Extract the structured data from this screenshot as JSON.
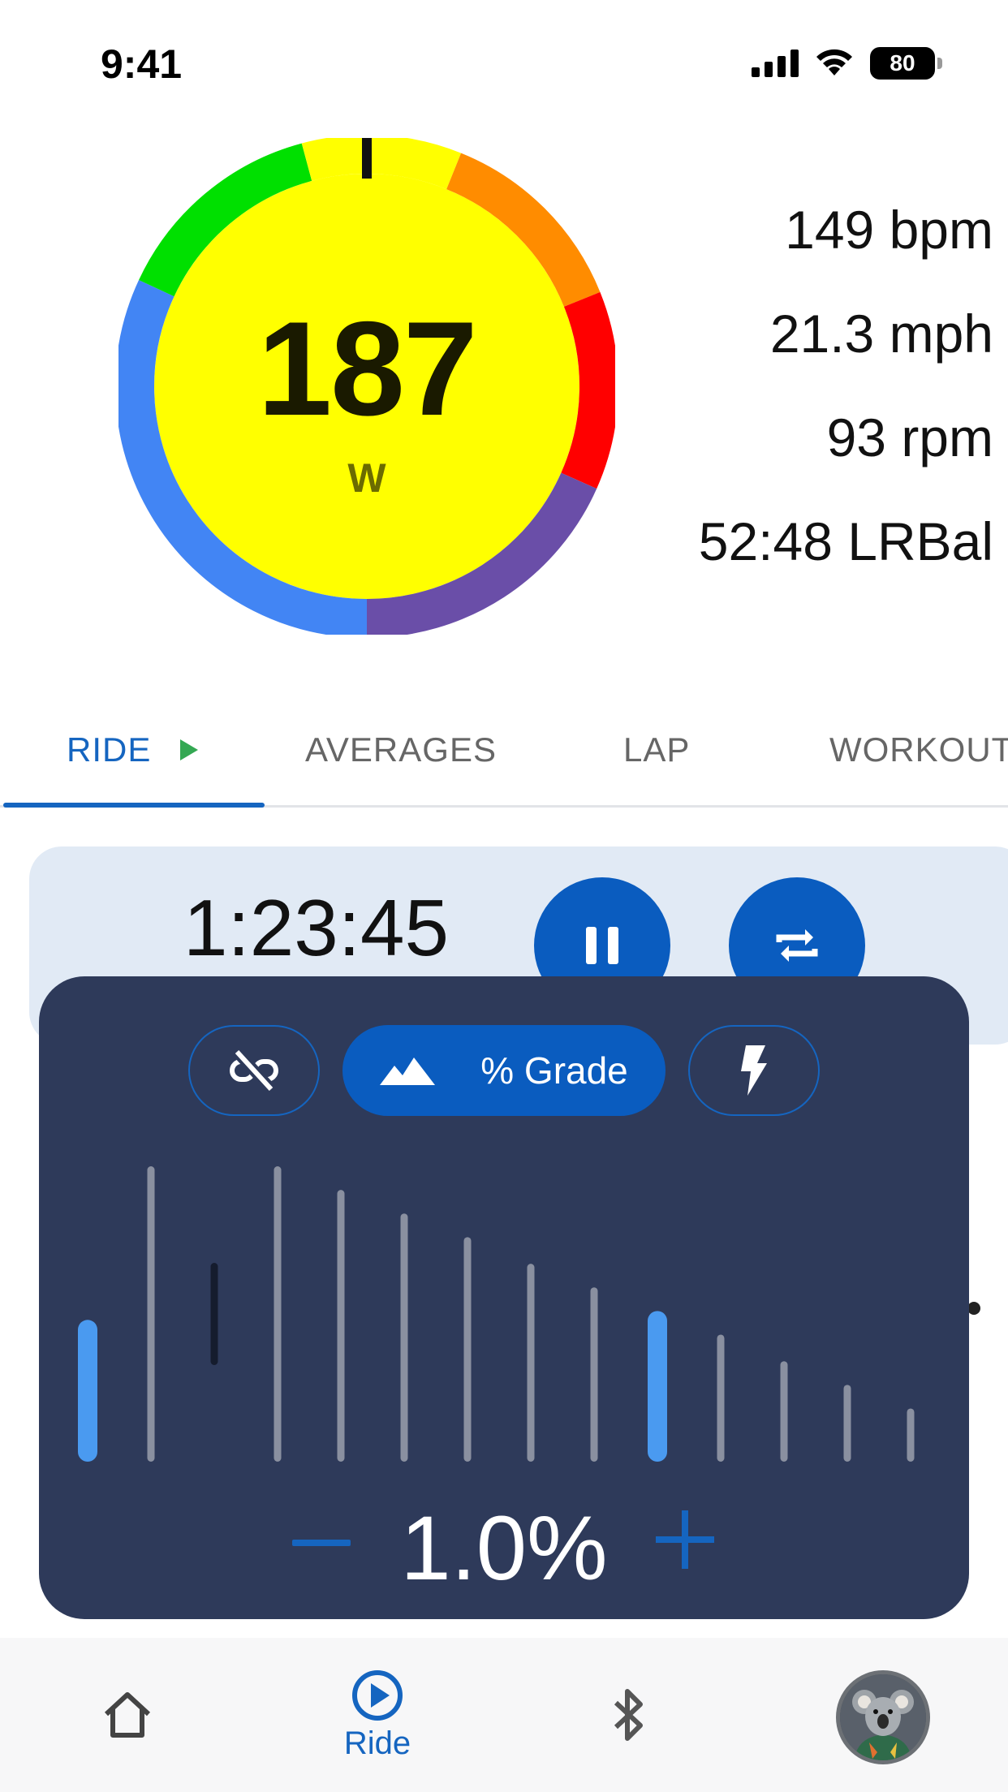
{
  "status_bar": {
    "time": "9:41",
    "battery": "80"
  },
  "gauge": {
    "value": "187",
    "unit": "W",
    "zone_colors": [
      "#4285f4",
      "#00e000",
      "#ffff00",
      "#ff8c00",
      "#ff0000",
      "#6a4ea8"
    ]
  },
  "metrics": [
    {
      "text": "149 bpm"
    },
    {
      "text": "21.3 mph"
    },
    {
      "text": "93 rpm"
    },
    {
      "text": "52:48 LRBal"
    }
  ],
  "tabs": [
    {
      "label": "RIDE",
      "active": true
    },
    {
      "label": "AVERAGES",
      "active": false
    },
    {
      "label": "LAP",
      "active": false
    },
    {
      "label": "WORKOUT",
      "active": false
    }
  ],
  "timer": {
    "elapsed": "1:23:45"
  },
  "grade_panel": {
    "mode_label": "% Grade",
    "value": "1.0%",
    "bar_levels": [
      0.48,
      1.0,
      0.34,
      1.0,
      0.92,
      0.84,
      0.76,
      0.67,
      0.59,
      0.51,
      0.43,
      0.34,
      0.26,
      0.18
    ],
    "bar_highlight": [
      true,
      false,
      false,
      false,
      false,
      false,
      false,
      false,
      false,
      true,
      false,
      false,
      false,
      false
    ]
  },
  "bottom_nav": {
    "ride_label": "Ride"
  },
  "colors": {
    "accent": "#0a5cbf",
    "panel": "#2e3a5a",
    "play": "#34a853"
  }
}
